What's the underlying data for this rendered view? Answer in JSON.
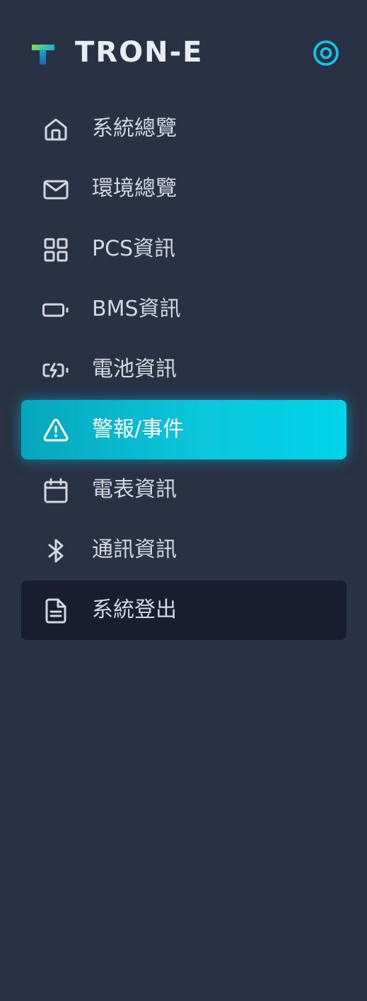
{
  "app": {
    "brand": "TRON-E",
    "logo_icon": "tron-e-logo",
    "settings_icon": "target-icon",
    "accent_color": "#00d4ea",
    "active_gradient": [
      "#06a6bd",
      "#00d4ea"
    ],
    "background": "#293245",
    "logout_background": "#181e30"
  },
  "nav": {
    "items": [
      {
        "label": "系統總覽",
        "icon": "home-icon",
        "state": "normal"
      },
      {
        "label": "環境總覽",
        "icon": "mail-icon",
        "state": "normal"
      },
      {
        "label": "PCS資訊",
        "icon": "grid-icon",
        "state": "normal"
      },
      {
        "label": "BMS資訊",
        "icon": "battery-icon",
        "state": "normal"
      },
      {
        "label": "電池資訊",
        "icon": "battery-charging-icon",
        "state": "normal"
      },
      {
        "label": "警報/事件",
        "icon": "alert-triangle-icon",
        "state": "active"
      },
      {
        "label": "電表資訊",
        "icon": "calendar-icon",
        "state": "normal"
      },
      {
        "label": "通訊資訊",
        "icon": "bluetooth-icon",
        "state": "normal"
      },
      {
        "label": "系統登出",
        "icon": "file-text-icon",
        "state": "dark"
      }
    ]
  }
}
